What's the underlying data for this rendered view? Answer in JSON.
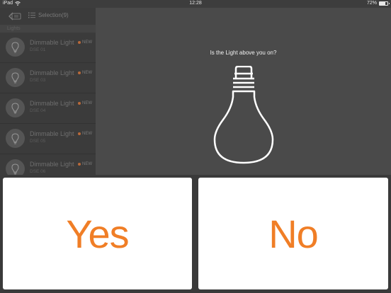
{
  "status_bar": {
    "device": "iPad",
    "time": "12:28",
    "battery": "72%",
    "battery_level": 0.72
  },
  "nav": {
    "selection_label": "Selection(9)"
  },
  "list": {
    "section": "Lights",
    "items": [
      {
        "name": "Dimmable Light",
        "sub": "DSE 01",
        "badge": "NEW"
      },
      {
        "name": "Dimmable Light",
        "sub": "DSE 03",
        "badge": "NEW"
      },
      {
        "name": "Dimmable Light",
        "sub": "DSE 04",
        "badge": "NEW"
      },
      {
        "name": "Dimmable Light",
        "sub": "DSE 05",
        "badge": "NEW"
      },
      {
        "name": "Dimmable Light",
        "sub": "DSE 06",
        "badge": "NEW"
      }
    ]
  },
  "prompt": {
    "question": "Is the Light above you on?"
  },
  "answers": {
    "yes": "Yes",
    "no": "No"
  },
  "colors": {
    "accent": "#f07e26",
    "badge_dot": "#b8693a"
  }
}
